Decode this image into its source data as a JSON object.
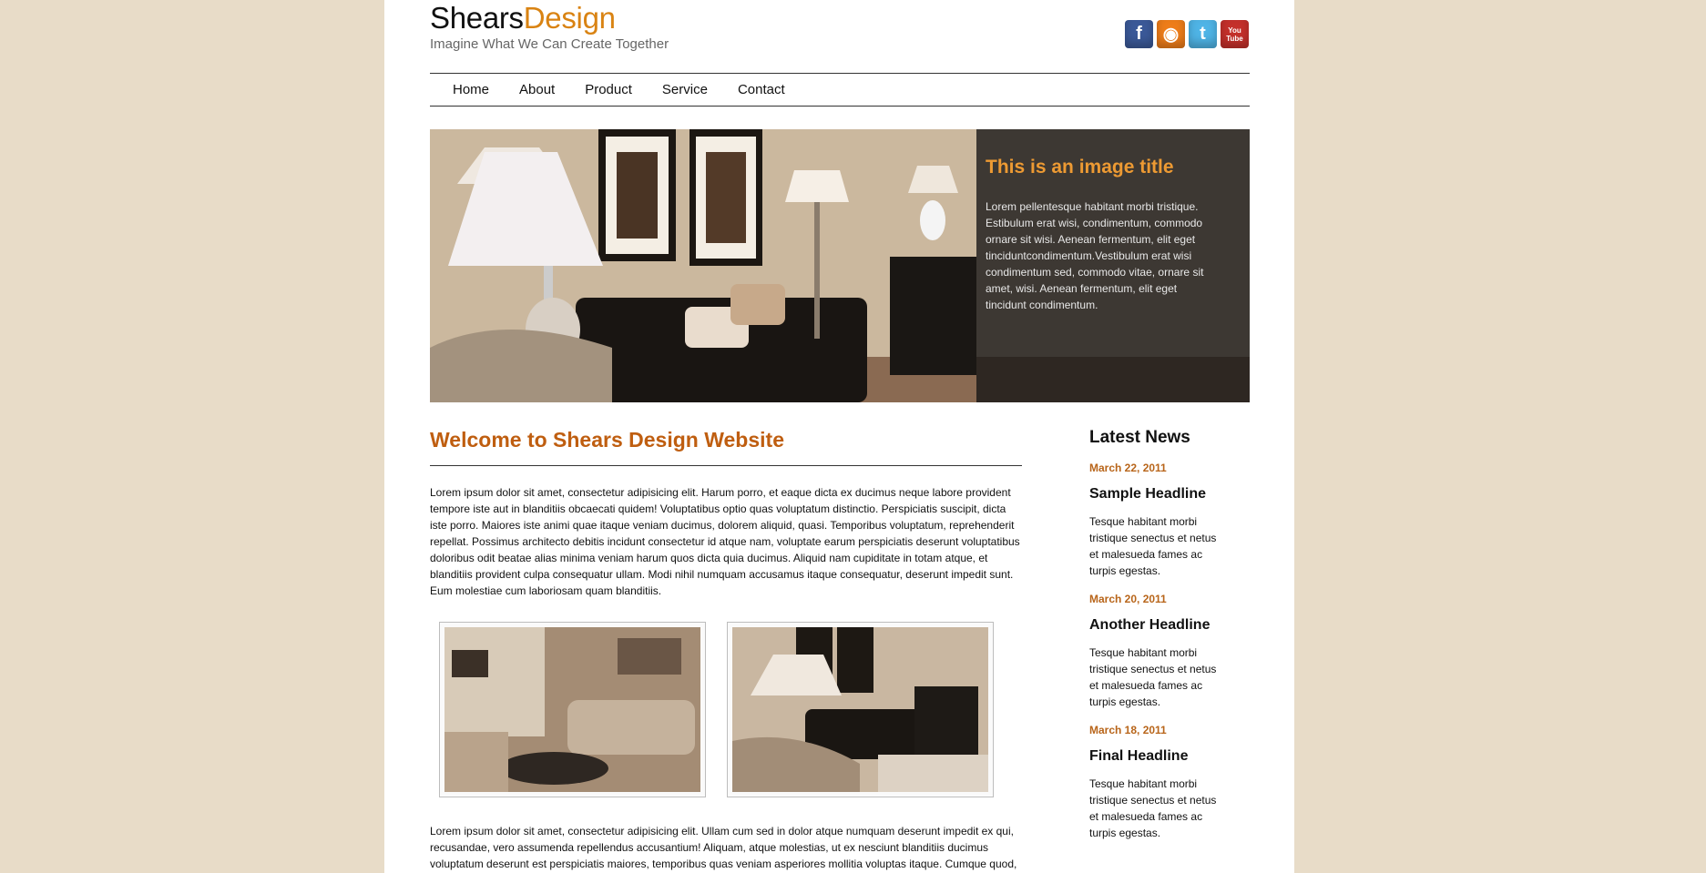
{
  "header": {
    "logo_part1": "Shears",
    "logo_part2": "Design",
    "tagline": "Imagine What We Can Create Together",
    "social": [
      {
        "name": "facebook-icon",
        "glyph": "f"
      },
      {
        "name": "rss-icon",
        "glyph": "◉"
      },
      {
        "name": "twitter-icon",
        "glyph": "t"
      },
      {
        "name": "youtube-icon",
        "glyph": "You Tube"
      }
    ]
  },
  "nav": [
    "Home",
    "About",
    "Product",
    "Service",
    "Contact"
  ],
  "hero": {
    "title": "This is an image title",
    "text": "Lorem pellentesque habitant morbi tristique. Estibulum erat wisi, condimentum, commodo ornare sit wisi. Aenean fermentum, elit eget tinciduntcondimentum.Vestibulum erat wisi condimentum sed, commodo vitae, ornare sit amet, wisi. Aenean fermentum, elit eget tincidunt condimentum."
  },
  "main": {
    "heading": "Welcome to Shears Design Website",
    "paragraph1": "Lorem ipsum dolor sit amet, consectetur adipisicing elit. Harum porro, et eaque dicta ex ducimus neque labore provident tempore iste aut in blanditiis obcaecati quidem! Voluptatibus optio quas voluptatum distinctio. Perspiciatis suscipit, dicta iste porro. Maiores iste animi quae itaque veniam ducimus, dolorem aliquid, quasi. Temporibus voluptatum, reprehenderit repellat. Possimus architecto debitis incidunt consectetur id atque nam, voluptate earum perspiciatis deserunt voluptatibus doloribus odit beatae alias minima veniam harum quos dicta quia ducimus. Aliquid nam cupiditate in totam atque, et blanditiis provident culpa consequatur ullam. Modi nihil numquam accusamus itaque consequatur, deserunt impedit sunt. Eum molestiae cum laboriosam quam blanditiis.",
    "paragraph2": "Lorem ipsum dolor sit amet, consectetur adipisicing elit. Ullam cum sed in dolor atque numquam deserunt impedit ex qui, recusandae, vero assumenda repellendus accusantium! Aliquam, atque molestias, ut ex nesciunt blanditiis ducimus voluptatum deserunt est perspiciatis maiores, temporibus quas veniam asperiores mollitia voluptas itaque. Cumque quod,"
  },
  "sidebar": {
    "title": "Latest News",
    "news": [
      {
        "date": "March 22, 2011",
        "headline": "Sample Headline",
        "text": "Tesque habitant morbi tristique senectus et netus et malesueda fames ac turpis egestas."
      },
      {
        "date": "March 20, 2011",
        "headline": "Another Headline",
        "text": "Tesque habitant morbi tristique senectus et netus et malesueda fames ac turpis egestas."
      },
      {
        "date": "March 18, 2011",
        "headline": "Final Headline",
        "text": "Tesque habitant morbi tristique senectus et netus et malesueda fames ac turpis egestas."
      }
    ]
  },
  "colors": {
    "background": "#e8dcc8",
    "accent_orange": "#d98313",
    "heading_orange": "#bf5e10"
  }
}
